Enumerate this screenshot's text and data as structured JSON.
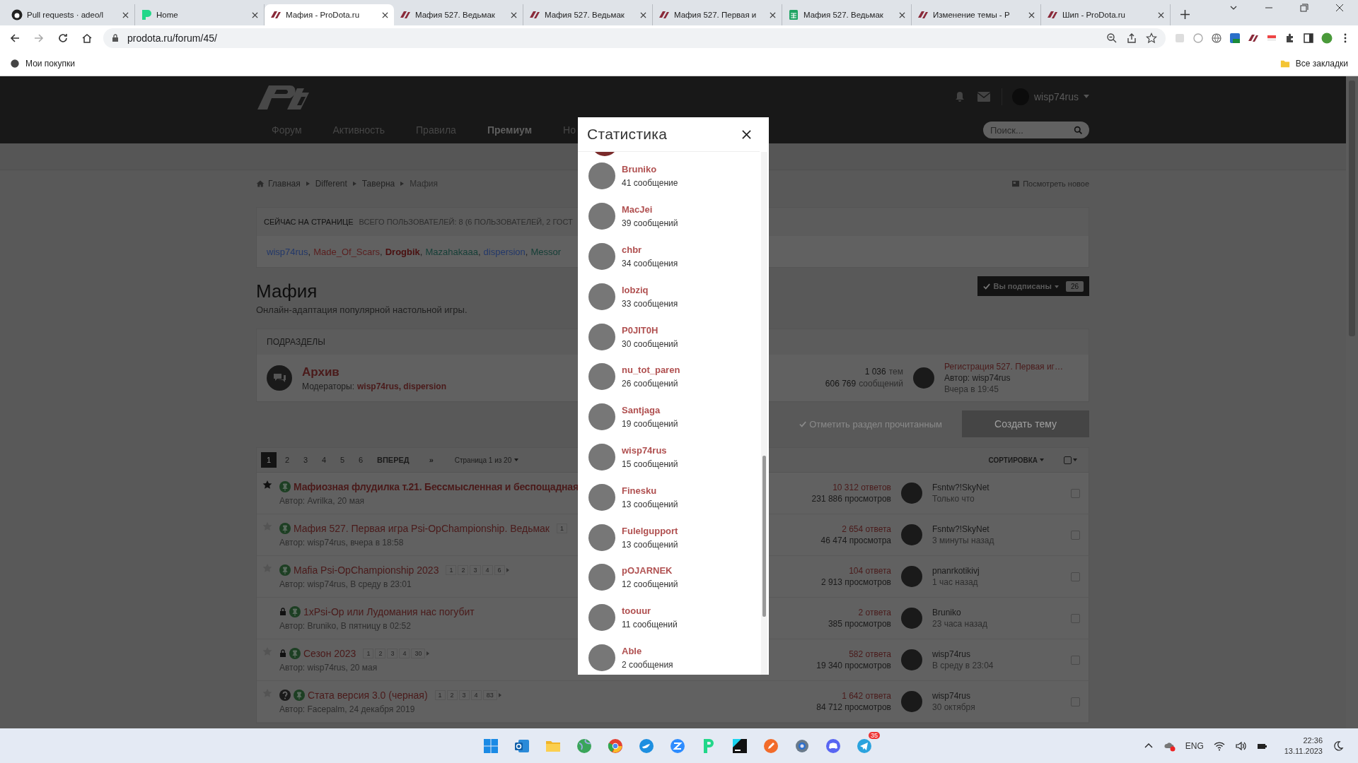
{
  "browser": {
    "tabs": [
      {
        "kind": "github",
        "title": "Pull requests · adeo/l",
        "selected": false
      },
      {
        "kind": "p",
        "title": "Home",
        "selected": false
      },
      {
        "kind": "site",
        "title": "Мафия - ProDota.ru",
        "selected": true
      },
      {
        "kind": "site",
        "title": "Мафия 527. Ведьмак",
        "selected": false
      },
      {
        "kind": "site",
        "title": "Мафия 527. Ведьмак",
        "selected": false
      },
      {
        "kind": "site",
        "title": "Мафия 527. Первая и",
        "selected": false
      },
      {
        "kind": "sheet",
        "title": "Мафия 527. Ведьмак",
        "selected": false
      },
      {
        "kind": "site",
        "title": "Изменение темы - P",
        "selected": false
      },
      {
        "kind": "site",
        "title": "Шип - ProDota.ru",
        "selected": false
      }
    ],
    "url": "prodota.ru/forum/45/",
    "bookmark": "Мои покупки",
    "all_bookmarks": "Все закладки"
  },
  "site": {
    "nav": [
      {
        "label": "Форум",
        "bold": false
      },
      {
        "label": "Активность",
        "bold": false
      },
      {
        "label": "Правила",
        "bold": false
      },
      {
        "label": "Премиум",
        "bold": true
      },
      {
        "label": "Но",
        "bold": false
      }
    ],
    "user": "wisp74rus",
    "search": {
      "placeholder": "Поиск..."
    }
  },
  "breadcrumb": [
    "Главная",
    "Different",
    "Таверна",
    "Мафия"
  ],
  "view_new": "Посмотреть новое",
  "online": {
    "heading": "СЕЙЧАС НА СТРАНИЦЕ",
    "summary": "ВСЕГО ПОЛЬЗОВАТЕЛЕЙ: 8  (6 ПОЛЬЗОВАТЕЛЕЙ, 2 ГОСТ",
    "separator": ",",
    "users": [
      {
        "name": "wisp74rus",
        "color": "#23386a",
        "bold": false
      },
      {
        "name": "Made_Of_Scars",
        "color": "#5a2020",
        "bold": false
      },
      {
        "name": "Drogbik",
        "color": "#4a1010",
        "bold": true
      },
      {
        "name": "Mazahakaaa",
        "color": "#153f37",
        "bold": false
      },
      {
        "name": "dispersion",
        "color": "#23386a",
        "bold": false
      },
      {
        "name": "Messor",
        "color": "#153f37",
        "bold": false
      }
    ]
  },
  "forum": {
    "title": "Мафия",
    "description": "Онлайн-адаптация популярной настольной игры.",
    "subscribe": "Вы подписаны",
    "subscribers": "26"
  },
  "subforums": {
    "heading": "ПОДРАЗДЕЛЫ",
    "items": [
      {
        "title": "Архив",
        "moderators_label": "Модераторы:",
        "moderators": "wisp74rus, dispersion",
        "topics": "1 036",
        "topics_label": "тем",
        "posts": "606 769",
        "posts_label": "сообщений",
        "last_title": "Регистрация 527. Первая иг…",
        "last_author": "Автор: wisp74rus",
        "last_time": "Вчера в 19:45"
      }
    ]
  },
  "actions": {
    "mark_read": "Отметить раздел прочитанным",
    "create": "Создать тему"
  },
  "pagination": {
    "pages": [
      {
        "label": "1",
        "selected": true
      },
      {
        "label": "2",
        "selected": false
      },
      {
        "label": "3",
        "selected": false
      },
      {
        "label": "4",
        "selected": false
      },
      {
        "label": "5",
        "selected": false
      },
      {
        "label": "6",
        "selected": false
      }
    ],
    "next": "ВПЕРЕД",
    "last": "»",
    "page_info": "Страница 1 из 20",
    "sort": "СОРТИРОВКА"
  },
  "topics": [
    {
      "starred": true,
      "locked": false,
      "question": false,
      "unread": true,
      "checked": false,
      "title": "Мафиозная флудилка т.21. Бессмысленная и беспощадная",
      "author": "Автор: Avrilka, 20 мая",
      "replies": "10 312 ответов",
      "views": "231 886 просмотров",
      "last_user": "Fsntw?!SkyNet",
      "last_time": "Только что"
    },
    {
      "starred": false,
      "locked": false,
      "question": false,
      "unread": false,
      "checked": false,
      "title": "Мафия 527. Первая игра Psi-OpChampionship. Ведьмак",
      "pages": [
        "1"
      ],
      "author": "Автор: wisp74rus, вчера в 18:58",
      "replies": "2 654 ответа",
      "views": "46 474 просмотра",
      "last_user": "Fsntw?!SkyNet",
      "last_time": "3 минуты назад"
    },
    {
      "starred": false,
      "locked": false,
      "question": false,
      "unread": false,
      "checked": false,
      "title": "Mafia Psi-OpChampionship 2023",
      "pages": [
        "1",
        "2",
        "3",
        "4",
        "6"
      ],
      "author": "Автор: wisp74rus, В среду в 23:01",
      "replies": "104 ответа",
      "views": "2 913 просмотров",
      "last_user": "pnanrkotikivj",
      "last_time": "1 час назад"
    },
    {
      "locked": true,
      "question": false,
      "unread": false,
      "checked": false,
      "title": "1xPsi-Op или Лудомания нас погубит",
      "author": "Автор: Bruniko, В пятницу в 02:52",
      "replies": "2 ответа",
      "views": "385 просмотров",
      "last_user": "Bruniko",
      "last_time": "23 часа назад"
    },
    {
      "starred": false,
      "locked": true,
      "question": false,
      "unread": false,
      "checked": false,
      "title": "Сезон 2023",
      "pages": [
        "1",
        "2",
        "3",
        "4",
        "30"
      ],
      "author": "Автор: wisp74rus, 20 мая",
      "replies": "582 ответа",
      "views": "19 340 просмотров",
      "last_user": "wisp74rus",
      "last_time": "В среду в 23:04"
    },
    {
      "starred": false,
      "locked": false,
      "question": true,
      "unread": false,
      "checked": false,
      "title": "Стата версия 3.0 (черная)",
      "pages": [
        "1",
        "2",
        "3",
        "4",
        "83"
      ],
      "author": "Автор: Facepalm, 24 декабря 2019",
      "replies": "1 642 ответа",
      "views": "84 712 просмотров",
      "last_user": "wisp74rus",
      "last_time": "30 октября"
    }
  ],
  "modal": {
    "title": "Статистика",
    "users": [
      {
        "name": "Bruniko",
        "posts": "41 сообщение"
      },
      {
        "name": "MacJei",
        "posts": "39 сообщений"
      },
      {
        "name": "chbr",
        "posts": "34 сообщения"
      },
      {
        "name": "lobziq",
        "posts": "33 сообщения"
      },
      {
        "name": "P0JIT0H",
        "posts": "30 сообщений"
      },
      {
        "name": "nu_tot_paren",
        "posts": "26 сообщений"
      },
      {
        "name": "Santjaga",
        "posts": "19 сообщений"
      },
      {
        "name": "wisp74rus",
        "posts": "15 сообщений"
      },
      {
        "name": "Finesku",
        "posts": "13 сообщений"
      },
      {
        "name": "Fulelgupport",
        "posts": "13 сообщений"
      },
      {
        "name": "pOJARNEK",
        "posts": "12 сообщений"
      },
      {
        "name": "toouur",
        "posts": "11 сообщений"
      },
      {
        "name": "Able",
        "posts": "2 сообщения"
      }
    ]
  },
  "taskbar": {
    "badge": "35",
    "language": "ENG",
    "time": "22:36",
    "date": "13.11.2023"
  }
}
